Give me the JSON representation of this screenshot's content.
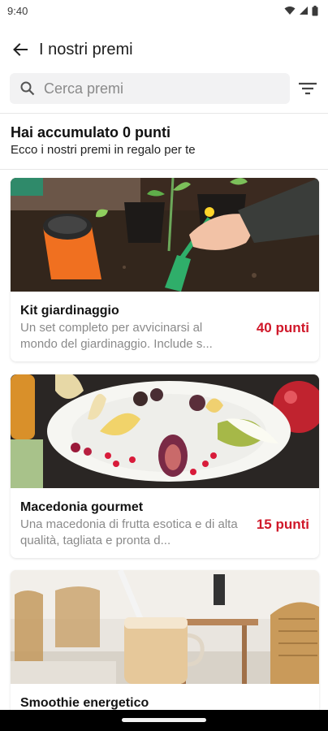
{
  "status_bar": {
    "time": "9:40",
    "icons": [
      "wifi-icon",
      "cellular-signal-icon",
      "battery-icon"
    ]
  },
  "app_bar": {
    "title": "I nostri premi",
    "back_icon": "arrow-back-icon"
  },
  "search": {
    "placeholder": "Cerca premi",
    "search_icon": "search-icon",
    "filter_icon": "filter-icon"
  },
  "points": {
    "title": "Hai accumulato 0 punti",
    "subtitle": "Ecco i nostri premi in regalo per te"
  },
  "rewards": [
    {
      "title": "Kit giardinaggio",
      "description": "Un set completo per avvicinarsi al mondo del giardinaggio. Include s...",
      "points": "40 punti"
    },
    {
      "title": "Macedonia gourmet",
      "description": "Una macedonia di frutta esotica e di alta qualità, tagliata e pronta d...",
      "points": "15 punti"
    },
    {
      "title": "Smoothie energetico",
      "description": "",
      "points": ""
    }
  ],
  "colors": {
    "accent": "#d0182a",
    "search_background": "#f2f2f3",
    "description_text": "#8a8a8a"
  }
}
